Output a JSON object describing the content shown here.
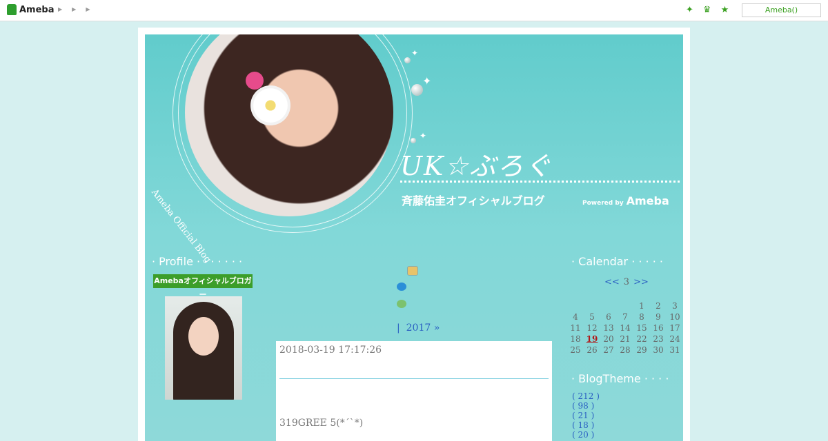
{
  "topbar": {
    "logo": "Ameba",
    "search_box": "Ameba()"
  },
  "header": {
    "title": "UK☆ぶろぐ",
    "subtitle": "斉藤佑圭オフィシャルブログ",
    "official": "Ameba Official Blog",
    "powered_by": "Powered by",
    "powered_brand": "Ameba"
  },
  "profile": {
    "heading": "Profile",
    "badge": "Amebaオフィシャルブロガー"
  },
  "archive": {
    "separator": "|",
    "year_link": "2017 »"
  },
  "post": {
    "date": "2018-03-19 17:17:26",
    "body": "319GREE 5(*´`*)"
  },
  "calendar": {
    "heading": "Calendar",
    "prev": "<<",
    "month": "3",
    "next": ">>",
    "today": "19",
    "weeks": [
      [
        "",
        "",
        "",
        "",
        "1",
        "2",
        "3"
      ],
      [
        "4",
        "5",
        "6",
        "7",
        "8",
        "9",
        "10"
      ],
      [
        "11",
        "12",
        "13",
        "14",
        "15",
        "16",
        "17"
      ],
      [
        "18",
        "19",
        "20",
        "21",
        "22",
        "23",
        "24"
      ],
      [
        "25",
        "26",
        "27",
        "28",
        "29",
        "30",
        "31"
      ]
    ]
  },
  "blog_theme": {
    "heading": "BlogTheme",
    "items": [
      "( 212 )",
      "( 98 )",
      "( 21 )",
      "( 18 )",
      "( 20 )"
    ]
  },
  "colors": {
    "accent": "#61cccc",
    "link": "#2a5fc2",
    "green": "#3c9e2a"
  }
}
